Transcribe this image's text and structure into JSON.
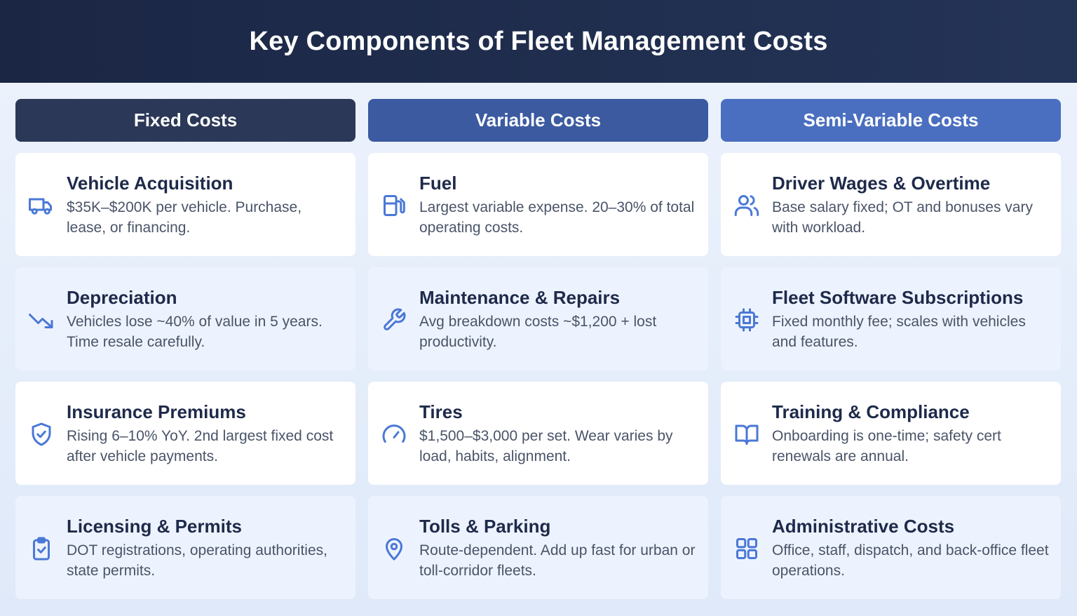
{
  "title": "Key Components of Fleet Management Costs",
  "columns": [
    {
      "heading": "Fixed Costs",
      "items": [
        {
          "icon": "truck-icon",
          "title": "Vehicle Acquisition",
          "desc": "$35K–$200K per vehicle. Purchase, lease, or financing."
        },
        {
          "icon": "trending-down-icon",
          "title": "Depreciation",
          "desc": "Vehicles lose ~40% of value in 5 years. Time resale carefully."
        },
        {
          "icon": "shield-check-icon",
          "title": "Insurance Premiums",
          "desc": "Rising 6–10% YoY. 2nd largest fixed cost after vehicle payments."
        },
        {
          "icon": "clipboard-check-icon",
          "title": "Licensing & Permits",
          "desc": "DOT registrations, operating authorities, state permits."
        }
      ]
    },
    {
      "heading": "Variable Costs",
      "items": [
        {
          "icon": "fuel-pump-icon",
          "title": "Fuel",
          "desc": "Largest variable expense. 20–30% of total operating costs."
        },
        {
          "icon": "wrench-icon",
          "title": "Maintenance & Repairs",
          "desc": "Avg breakdown costs ~$1,200 + lost productivity."
        },
        {
          "icon": "gauge-icon",
          "title": "Tires",
          "desc": "$1,500–$3,000 per set. Wear varies by load, habits, alignment."
        },
        {
          "icon": "map-pin-icon",
          "title": "Tolls & Parking",
          "desc": "Route-dependent. Add up fast for urban or toll-corridor fleets."
        }
      ]
    },
    {
      "heading": "Semi-Variable Costs",
      "items": [
        {
          "icon": "users-icon",
          "title": "Driver Wages & Overtime",
          "desc": "Base salary fixed; OT and bonuses vary with workload."
        },
        {
          "icon": "cpu-icon",
          "title": "Fleet Software Subscriptions",
          "desc": "Fixed monthly fee; scales with vehicles and features."
        },
        {
          "icon": "book-open-icon",
          "title": "Training & Compliance",
          "desc": "Onboarding is one-time; safety cert renewals are annual."
        },
        {
          "icon": "grid-icon",
          "title": "Administrative Costs",
          "desc": "Office, staff, dispatch, and back-office fleet operations."
        }
      ]
    }
  ]
}
